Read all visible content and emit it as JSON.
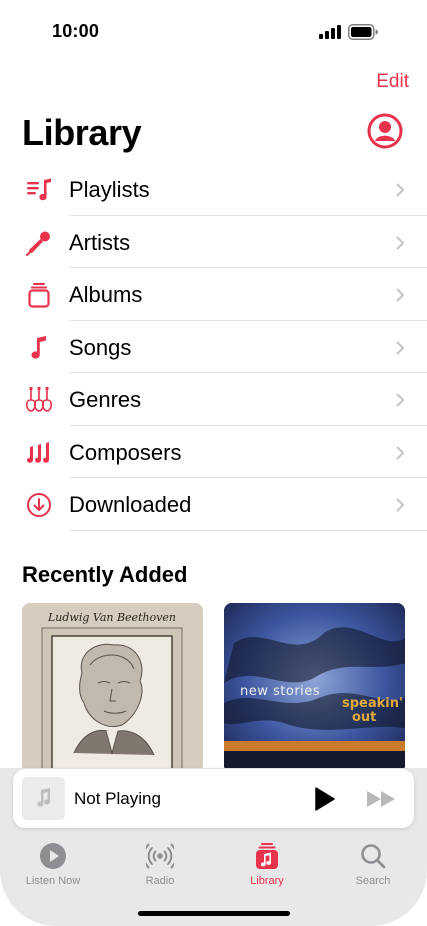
{
  "status_bar": {
    "time": "10:00"
  },
  "header": {
    "edit_label": "Edit",
    "title": "Library"
  },
  "library": {
    "items": [
      {
        "label": "Playlists",
        "icon": "playlist-icon"
      },
      {
        "label": "Artists",
        "icon": "microphone-icon"
      },
      {
        "label": "Albums",
        "icon": "album-stack-icon"
      },
      {
        "label": "Songs",
        "icon": "music-note-icon"
      },
      {
        "label": "Genres",
        "icon": "guitars-icon"
      },
      {
        "label": "Composers",
        "icon": "notes-icon"
      },
      {
        "label": "Downloaded",
        "icon": "download-circle-icon"
      }
    ]
  },
  "recently_added": {
    "title": "Recently Added",
    "albums": [
      {
        "cover_text": "Ludwig Van Beethoven"
      },
      {
        "cover_text_1": "new stories",
        "cover_text_2": "speakin'",
        "cover_text_3": "out"
      }
    ]
  },
  "mini_player": {
    "title": "Not Playing"
  },
  "tabs": [
    {
      "label": "Listen Now",
      "icon": "play-circle-icon"
    },
    {
      "label": "Radio",
      "icon": "radio-waves-icon"
    },
    {
      "label": "Library",
      "icon": "library-icon",
      "active": true
    },
    {
      "label": "Search",
      "icon": "search-icon"
    }
  ],
  "colors": {
    "accent": "#e8334d",
    "tab_inactive": "#8e8e93",
    "tab_bar": "#e9e7e7"
  }
}
